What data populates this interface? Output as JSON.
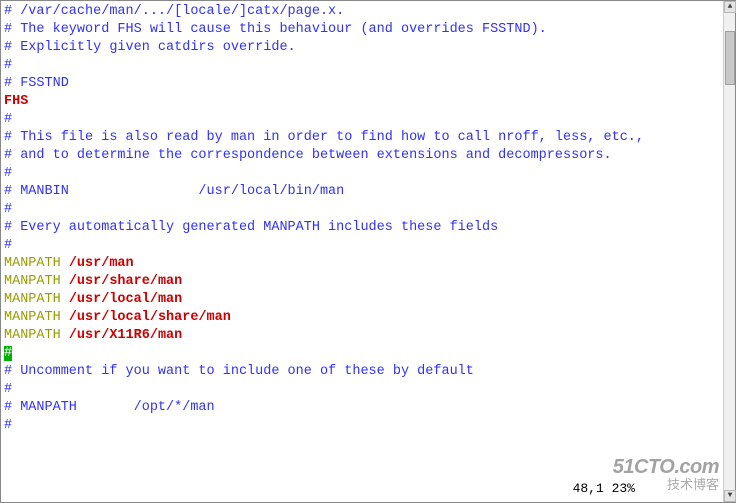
{
  "lines": [
    {
      "segs": [
        {
          "t": "# /var/cache/man/.../[locale/]catx/page.x.",
          "cls": "c-blue"
        }
      ]
    },
    {
      "segs": [
        {
          "t": "# The keyword FHS will cause this behaviour (and overrides FSSTND).",
          "cls": "c-blue"
        }
      ]
    },
    {
      "segs": [
        {
          "t": "# Explicitly given catdirs override.",
          "cls": "c-blue"
        }
      ]
    },
    {
      "segs": [
        {
          "t": "#",
          "cls": "c-blue"
        }
      ]
    },
    {
      "segs": [
        {
          "t": "# FSSTND",
          "cls": "c-blue"
        }
      ]
    },
    {
      "segs": [
        {
          "t": "FHS",
          "cls": "c-red"
        }
      ]
    },
    {
      "segs": [
        {
          "t": "#",
          "cls": "c-blue"
        }
      ]
    },
    {
      "segs": [
        {
          "t": "# This file is also read by man in order to find how to call nroff, less, etc.,",
          "cls": "c-blue"
        }
      ]
    },
    {
      "segs": [
        {
          "t": "# and to determine the correspondence between extensions and decompressors.",
          "cls": "c-blue"
        }
      ]
    },
    {
      "segs": [
        {
          "t": "#",
          "cls": "c-blue"
        }
      ]
    },
    {
      "segs": [
        {
          "t": "# MANBIN                /usr/local/bin/man",
          "cls": "c-blue"
        }
      ]
    },
    {
      "segs": [
        {
          "t": "#",
          "cls": "c-blue"
        }
      ]
    },
    {
      "segs": [
        {
          "t": "# Every automatically generated MANPATH includes these fields",
          "cls": "c-blue"
        }
      ]
    },
    {
      "segs": [
        {
          "t": "#",
          "cls": "c-blue"
        }
      ]
    },
    {
      "segs": [
        {
          "t": "MANPATH",
          "cls": "c-olive"
        },
        {
          "t": " ",
          "cls": "c-black"
        },
        {
          "t": "/usr/man",
          "cls": "c-red"
        }
      ]
    },
    {
      "segs": [
        {
          "t": "MANPATH",
          "cls": "c-olive"
        },
        {
          "t": " ",
          "cls": "c-black"
        },
        {
          "t": "/usr/share/man",
          "cls": "c-red"
        }
      ]
    },
    {
      "segs": [
        {
          "t": "MANPATH",
          "cls": "c-olive"
        },
        {
          "t": " ",
          "cls": "c-black"
        },
        {
          "t": "/usr/local/man",
          "cls": "c-red"
        }
      ]
    },
    {
      "segs": [
        {
          "t": "MANPATH",
          "cls": "c-olive"
        },
        {
          "t": " ",
          "cls": "c-black"
        },
        {
          "t": "/usr/local/share/man",
          "cls": "c-red"
        }
      ]
    },
    {
      "segs": [
        {
          "t": "MANPATH",
          "cls": "c-olive"
        },
        {
          "t": " ",
          "cls": "c-black"
        },
        {
          "t": "/usr/X11R6/man",
          "cls": "c-red"
        }
      ]
    },
    {
      "segs": [
        {
          "t": "#",
          "cls": "cursor-bg"
        }
      ]
    },
    {
      "segs": [
        {
          "t": "# Uncomment if you want to include one of these by default",
          "cls": "c-blue"
        }
      ]
    },
    {
      "segs": [
        {
          "t": "#",
          "cls": "c-blue"
        }
      ]
    },
    {
      "segs": [
        {
          "t": "# MANPATH       /opt/*/man",
          "cls": "c-blue"
        }
      ]
    },
    {
      "segs": [
        {
          "t": "#",
          "cls": "c-blue"
        }
      ]
    }
  ],
  "status": "48,1         23%",
  "watermark": {
    "main": "51CTO.com",
    "sub": "技术博客"
  }
}
